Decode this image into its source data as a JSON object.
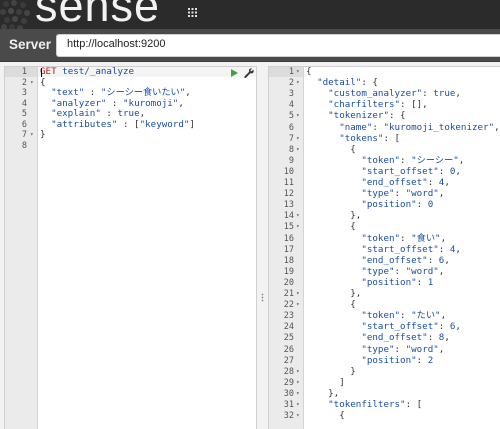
{
  "app": {
    "logo_text": "sense"
  },
  "server": {
    "label": "Server",
    "url": "http://localhost:9200"
  },
  "icons": {
    "logo": "sense-logo-icon",
    "apps_grid": "grid-icon",
    "send": "play-icon",
    "settings": "wrench-icon",
    "resize": "drag-handle-icon"
  },
  "colors": {
    "topbar": "#2b2b2b",
    "serverbar": "#4a4a4a",
    "method": "#b22222",
    "code": "#1a4ea1",
    "send_button": "#43a047"
  },
  "request_editor": {
    "lines": [
      {
        "n": "1",
        "fold": "",
        "tokens": [
          [
            "k-method",
            "GET"
          ],
          [
            "k-punc",
            " "
          ],
          [
            "k-url",
            "test/_analyze"
          ]
        ]
      },
      {
        "n": "2",
        "fold": "▾",
        "tokens": [
          [
            "k-punc",
            "{"
          ]
        ]
      },
      {
        "n": "3",
        "fold": "",
        "tokens": [
          [
            "k-key",
            "  \"text\""
          ],
          [
            "k-punc",
            " : "
          ],
          [
            "k-str",
            "\"シーシー食いたい\""
          ],
          [
            "k-punc",
            ","
          ]
        ]
      },
      {
        "n": "4",
        "fold": "",
        "tokens": [
          [
            "k-key",
            "  \"analyzer\""
          ],
          [
            "k-punc",
            " : "
          ],
          [
            "k-str",
            "\"kuromoji\""
          ],
          [
            "k-punc",
            ","
          ]
        ]
      },
      {
        "n": "5",
        "fold": "",
        "tokens": [
          [
            "k-key",
            "  \"explain\""
          ],
          [
            "k-punc",
            " : "
          ],
          [
            "k-bool",
            "true"
          ],
          [
            "k-punc",
            ","
          ]
        ]
      },
      {
        "n": "6",
        "fold": "",
        "tokens": [
          [
            "k-key",
            "  \"attributes\""
          ],
          [
            "k-punc",
            " : ["
          ],
          [
            "k-str",
            "\"keyword\""
          ],
          [
            "k-punc",
            "]"
          ]
        ]
      },
      {
        "n": "7",
        "fold": "▾",
        "tokens": [
          [
            "k-punc",
            "}"
          ]
        ]
      },
      {
        "n": "8",
        "fold": "",
        "tokens": []
      }
    ]
  },
  "response_viewer": {
    "lines": [
      {
        "n": "1",
        "fold": "▾",
        "tokens": [
          [
            "k-punc",
            "{"
          ]
        ]
      },
      {
        "n": "2",
        "fold": "▾",
        "tokens": [
          [
            "k-key",
            "  \"detail\""
          ],
          [
            "k-punc",
            ": {"
          ]
        ]
      },
      {
        "n": "3",
        "fold": "",
        "tokens": [
          [
            "k-key",
            "    \"custom_analyzer\""
          ],
          [
            "k-punc",
            ": "
          ],
          [
            "k-bool",
            "true"
          ],
          [
            "k-punc",
            ","
          ]
        ]
      },
      {
        "n": "4",
        "fold": "",
        "tokens": [
          [
            "k-key",
            "    \"charfilters\""
          ],
          [
            "k-punc",
            ": [],"
          ]
        ]
      },
      {
        "n": "5",
        "fold": "▾",
        "tokens": [
          [
            "k-key",
            "    \"tokenizer\""
          ],
          [
            "k-punc",
            ": {"
          ]
        ]
      },
      {
        "n": "6",
        "fold": "",
        "tokens": [
          [
            "k-key",
            "      \"name\""
          ],
          [
            "k-punc",
            ": "
          ],
          [
            "k-str",
            "\"kuromoji_tokenizer\""
          ],
          [
            "k-punc",
            ","
          ]
        ]
      },
      {
        "n": "7",
        "fold": "▾",
        "tokens": [
          [
            "k-key",
            "      \"tokens\""
          ],
          [
            "k-punc",
            ": ["
          ]
        ]
      },
      {
        "n": "8",
        "fold": "▾",
        "tokens": [
          [
            "k-punc",
            "        {"
          ]
        ]
      },
      {
        "n": "9",
        "fold": "",
        "tokens": [
          [
            "k-key",
            "          \"token\""
          ],
          [
            "k-punc",
            ": "
          ],
          [
            "k-str",
            "\"シーシー\""
          ],
          [
            "k-punc",
            ","
          ]
        ]
      },
      {
        "n": "10",
        "fold": "",
        "tokens": [
          [
            "k-key",
            "          \"start_offset\""
          ],
          [
            "k-punc",
            ": "
          ],
          [
            "k-num",
            "0"
          ],
          [
            "k-punc",
            ","
          ]
        ]
      },
      {
        "n": "11",
        "fold": "",
        "tokens": [
          [
            "k-key",
            "          \"end_offset\""
          ],
          [
            "k-punc",
            ": "
          ],
          [
            "k-num",
            "4"
          ],
          [
            "k-punc",
            ","
          ]
        ]
      },
      {
        "n": "12",
        "fold": "",
        "tokens": [
          [
            "k-key",
            "          \"type\""
          ],
          [
            "k-punc",
            ": "
          ],
          [
            "k-str",
            "\"word\""
          ],
          [
            "k-punc",
            ","
          ]
        ]
      },
      {
        "n": "13",
        "fold": "",
        "tokens": [
          [
            "k-key",
            "          \"position\""
          ],
          [
            "k-punc",
            ": "
          ],
          [
            "k-num",
            "0"
          ]
        ]
      },
      {
        "n": "14",
        "fold": "▾",
        "tokens": [
          [
            "k-punc",
            "        },"
          ]
        ]
      },
      {
        "n": "15",
        "fold": "▾",
        "tokens": [
          [
            "k-punc",
            "        {"
          ]
        ]
      },
      {
        "n": "16",
        "fold": "",
        "tokens": [
          [
            "k-key",
            "          \"token\""
          ],
          [
            "k-punc",
            ": "
          ],
          [
            "k-str",
            "\"食い\""
          ],
          [
            "k-punc",
            ","
          ]
        ]
      },
      {
        "n": "17",
        "fold": "",
        "tokens": [
          [
            "k-key",
            "          \"start_offset\""
          ],
          [
            "k-punc",
            ": "
          ],
          [
            "k-num",
            "4"
          ],
          [
            "k-punc",
            ","
          ]
        ]
      },
      {
        "n": "18",
        "fold": "",
        "tokens": [
          [
            "k-key",
            "          \"end_offset\""
          ],
          [
            "k-punc",
            ": "
          ],
          [
            "k-num",
            "6"
          ],
          [
            "k-punc",
            ","
          ]
        ]
      },
      {
        "n": "19",
        "fold": "",
        "tokens": [
          [
            "k-key",
            "          \"type\""
          ],
          [
            "k-punc",
            ": "
          ],
          [
            "k-str",
            "\"word\""
          ],
          [
            "k-punc",
            ","
          ]
        ]
      },
      {
        "n": "20",
        "fold": "",
        "tokens": [
          [
            "k-key",
            "          \"position\""
          ],
          [
            "k-punc",
            ": "
          ],
          [
            "k-num",
            "1"
          ]
        ]
      },
      {
        "n": "21",
        "fold": "▾",
        "tokens": [
          [
            "k-punc",
            "        },"
          ]
        ]
      },
      {
        "n": "22",
        "fold": "▾",
        "tokens": [
          [
            "k-punc",
            "        {"
          ]
        ]
      },
      {
        "n": "23",
        "fold": "",
        "tokens": [
          [
            "k-key",
            "          \"token\""
          ],
          [
            "k-punc",
            ": "
          ],
          [
            "k-str",
            "\"たい\""
          ],
          [
            "k-punc",
            ","
          ]
        ]
      },
      {
        "n": "24",
        "fold": "",
        "tokens": [
          [
            "k-key",
            "          \"start_offset\""
          ],
          [
            "k-punc",
            ": "
          ],
          [
            "k-num",
            "6"
          ],
          [
            "k-punc",
            ","
          ]
        ]
      },
      {
        "n": "25",
        "fold": "",
        "tokens": [
          [
            "k-key",
            "          \"end_offset\""
          ],
          [
            "k-punc",
            ": "
          ],
          [
            "k-num",
            "8"
          ],
          [
            "k-punc",
            ","
          ]
        ]
      },
      {
        "n": "26",
        "fold": "",
        "tokens": [
          [
            "k-key",
            "          \"type\""
          ],
          [
            "k-punc",
            ": "
          ],
          [
            "k-str",
            "\"word\""
          ],
          [
            "k-punc",
            ","
          ]
        ]
      },
      {
        "n": "27",
        "fold": "",
        "tokens": [
          [
            "k-key",
            "          \"position\""
          ],
          [
            "k-punc",
            ": "
          ],
          [
            "k-num",
            "2"
          ]
        ]
      },
      {
        "n": "28",
        "fold": "▾",
        "tokens": [
          [
            "k-punc",
            "        }"
          ]
        ]
      },
      {
        "n": "29",
        "fold": "▾",
        "tokens": [
          [
            "k-punc",
            "      ]"
          ]
        ]
      },
      {
        "n": "30",
        "fold": "▾",
        "tokens": [
          [
            "k-punc",
            "    },"
          ]
        ]
      },
      {
        "n": "31",
        "fold": "▾",
        "tokens": [
          [
            "k-key",
            "    \"tokenfilters\""
          ],
          [
            "k-punc",
            ": ["
          ]
        ]
      },
      {
        "n": "32",
        "fold": "▾",
        "tokens": [
          [
            "k-punc",
            "      {"
          ]
        ]
      }
    ]
  }
}
